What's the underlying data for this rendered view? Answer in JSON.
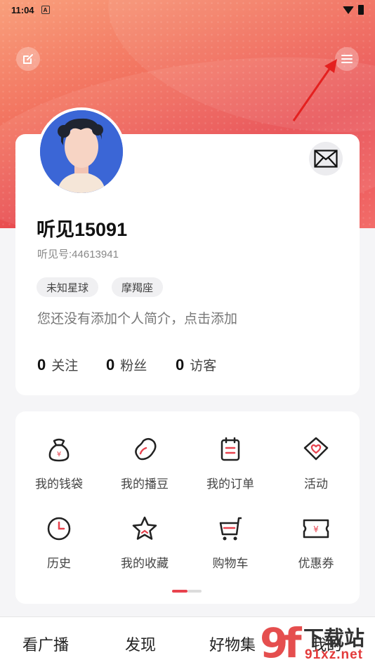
{
  "status_bar": {
    "time": "11:04",
    "notif_icon": "A"
  },
  "header": {
    "edit_icon": "edit-icon",
    "menu_icon": "hamburger-menu-icon"
  },
  "profile": {
    "username": "听见15091",
    "user_id": "听见号:44613941",
    "tags": [
      "未知星球",
      "摩羯座"
    ],
    "bio_placeholder": "您还没有添加个人简介，点击添加",
    "stats": [
      {
        "count": "0",
        "label": "关注"
      },
      {
        "count": "0",
        "label": "粉丝"
      },
      {
        "count": "0",
        "label": "访客"
      }
    ]
  },
  "menu_grid": {
    "items": [
      {
        "label": "我的钱袋",
        "icon": "money-bag-icon"
      },
      {
        "label": "我的播豆",
        "icon": "bean-icon"
      },
      {
        "label": "我的订单",
        "icon": "order-clipboard-icon"
      },
      {
        "label": "活动",
        "icon": "heart-badge-icon"
      },
      {
        "label": "历史",
        "icon": "clock-icon"
      },
      {
        "label": "我的收藏",
        "icon": "star-icon"
      },
      {
        "label": "购物车",
        "icon": "cart-icon"
      },
      {
        "label": "优惠券",
        "icon": "coupon-icon"
      }
    ]
  },
  "tab_bar": {
    "tabs": [
      "看广播",
      "发现",
      "好物集",
      "我的"
    ]
  },
  "watermark": {
    "brand": "下载站",
    "domain": "91xz.net",
    "logo": "9f"
  },
  "colors": {
    "accent": "#e8424e",
    "hero_start": "#f9a07c",
    "hero_end": "#e84a4f"
  }
}
